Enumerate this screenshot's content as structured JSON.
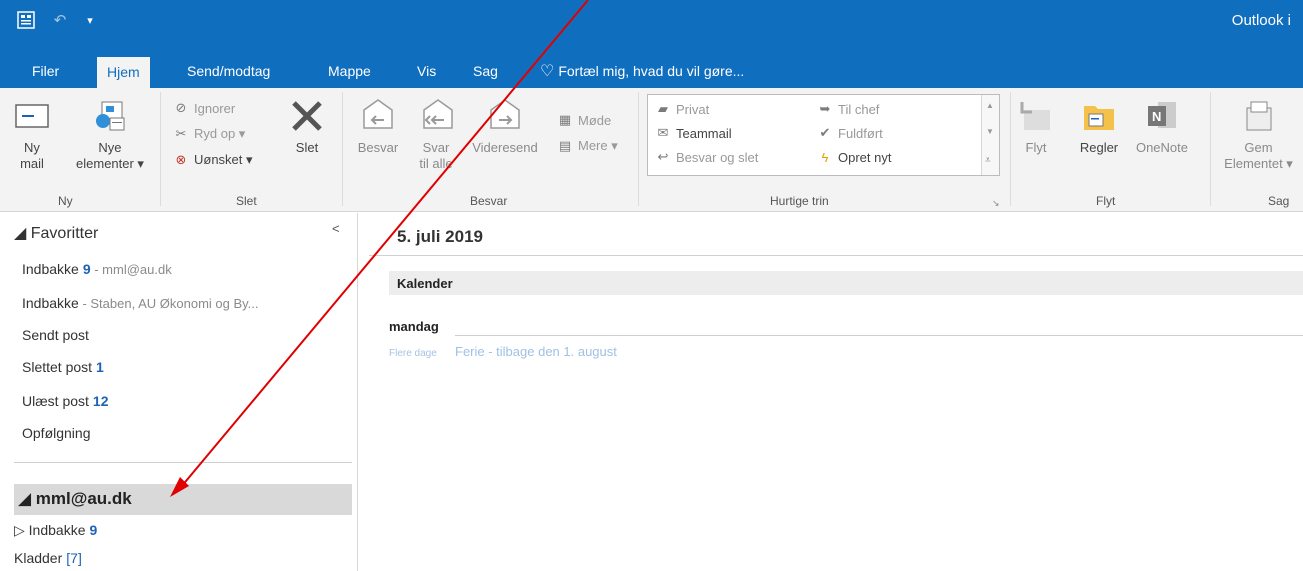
{
  "app": {
    "title": "Outlook i"
  },
  "tabs": [
    {
      "label": "Filer"
    },
    {
      "label": "Hjem"
    },
    {
      "label": "Send/modtag"
    },
    {
      "label": "Mappe"
    },
    {
      "label": "Vis"
    },
    {
      "label": "Sag"
    }
  ],
  "tell_me": {
    "label": "Fortæl mig, hvad du vil gøre..."
  },
  "ribbon": {
    "ny": {
      "new_mail": "Ny\nmail",
      "new_items": "Nye\nelementer ▾",
      "group": "Ny"
    },
    "slet": {
      "ignore": "Ignorer",
      "cleanup": "Ryd op ▾",
      "junk": "Uønsket ▾",
      "delete": "Slet",
      "group": "Slet"
    },
    "besvar": {
      "reply": "Besvar",
      "reply_all": "Svar\ntil alle",
      "forward": "Videresend",
      "meeting": "Møde",
      "more": "Mere ▾",
      "group": "Besvar"
    },
    "quick_steps": {
      "private": "Privat",
      "team_mail": "Teammail",
      "reply_delete": "Besvar og slet",
      "to_manager": "Til chef",
      "done": "Fuldført",
      "create_new": "Opret nyt",
      "group": "Hurtige trin"
    },
    "flyt": {
      "move": "Flyt",
      "rules": "Regler",
      "onenote": "OneNote",
      "group": "Flyt"
    },
    "sag": {
      "save": "Gem\nElementet ▾",
      "group": "Sag"
    }
  },
  "nav": {
    "favorites_header": "◢ Favoritter",
    "collapse": "<",
    "favorites": [
      {
        "name": "Indbakke",
        "count": "9",
        "sub": " - mml@au.dk"
      },
      {
        "name": "Indbakke",
        "count": "",
        "sub": " - Staben, AU Økonomi og By..."
      },
      {
        "name": "Sendt post",
        "count": "",
        "sub": ""
      },
      {
        "name": "Slettet post",
        "count": "1",
        "sub": ""
      },
      {
        "name": "Ulæst post",
        "count": "12",
        "sub": ""
      },
      {
        "name": "Opfølgning",
        "count": "",
        "sub": ""
      }
    ],
    "account": "◢ mml@au.dk",
    "account_folders": [
      {
        "name": "▷ Indbakke",
        "count": "9"
      },
      {
        "name": "Kladder",
        "count": "[7]"
      }
    ]
  },
  "main": {
    "date": "5. juli 2019",
    "calendar_header": "Kalender",
    "day": "mandag",
    "event_meta": "Flere dage",
    "event_title": "Ferie - tilbage den 1. august"
  },
  "colors": {
    "brand": "#106ebe",
    "annotation_arrow": "#e00000",
    "count": "#1e62b4"
  }
}
